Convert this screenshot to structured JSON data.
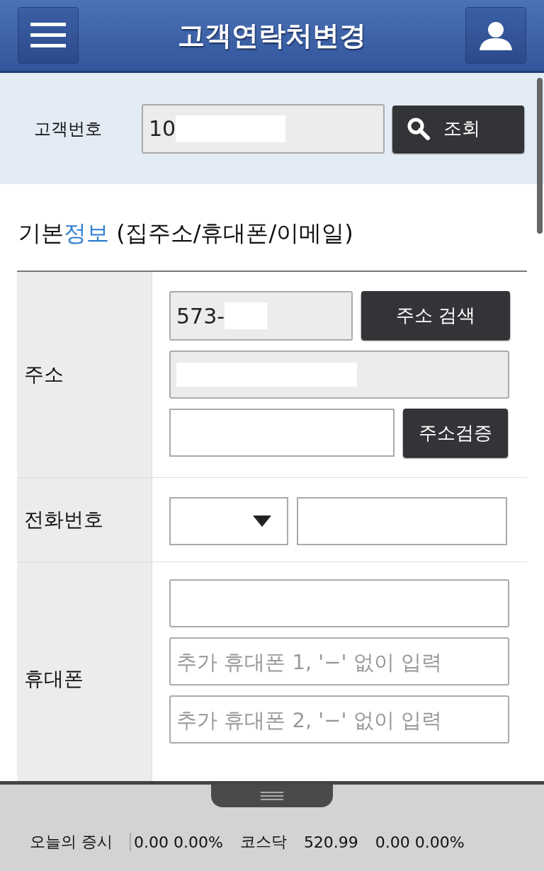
{
  "header": {
    "title": "고객연락처변경"
  },
  "search": {
    "label": "고객번호",
    "value": "10",
    "redacted": true,
    "button": "조회"
  },
  "section": {
    "parts": [
      {
        "text": "기본",
        "highlight": false
      },
      {
        "text": "정보",
        "highlight": true
      },
      {
        "text": " (집주소/휴대폰/이메일)",
        "highlight": false
      }
    ]
  },
  "rows": [
    {
      "kind": "address",
      "label": "주소",
      "zip": {
        "value": "573-",
        "redacted": true
      },
      "zip_button": "주소 검색",
      "address1": {
        "redacted": true
      },
      "verify_button": "주소검증"
    },
    {
      "kind": "phone",
      "label": "전화번호"
    },
    {
      "kind": "mobile",
      "label": "휴대폰",
      "fields": [
        {
          "kind": "plain"
        },
        {
          "kind": "hint",
          "placeholder": "추가 휴대폰 1, '−' 없이 입력"
        },
        {
          "kind": "hint",
          "placeholder": "추가 휴대폰 2, '−' 없이 입력"
        }
      ]
    }
  ],
  "footer": {
    "label": "오늘의 증시",
    "items": [
      "0.00 0.00%",
      "코스닥",
      "520.99",
      "0.00 0.00%"
    ]
  }
}
